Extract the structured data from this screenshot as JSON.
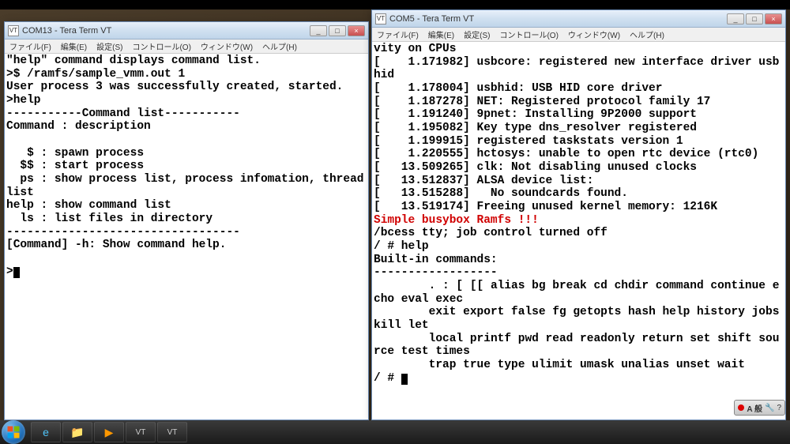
{
  "left_window": {
    "title": "COM13 - Tera Term VT",
    "menu": [
      "ファイル(F)",
      "編集(E)",
      "設定(S)",
      "コントロール(O)",
      "ウィンドウ(W)",
      "ヘルプ(H)"
    ],
    "lines": [
      {
        "t": "\"help\" command displays command list."
      },
      {
        "t": ">$ /ramfs/sample_vmm.out 1"
      },
      {
        "t": "User process 3 was successfully created, started."
      },
      {
        "t": ">help"
      },
      {
        "t": "-----------Command list-----------"
      },
      {
        "t": "Command : description"
      },
      {
        "t": ""
      },
      {
        "t": "   $ : spawn process"
      },
      {
        "t": "  $$ : start process"
      },
      {
        "t": "  ps : show process list, process infomation, thread list"
      },
      {
        "t": "help : show command list"
      },
      {
        "t": "  ls : list files in directory"
      },
      {
        "t": "----------------------------------"
      },
      {
        "t": "[Command] -h: Show command help."
      },
      {
        "t": ""
      }
    ],
    "prompt": ">"
  },
  "right_window": {
    "title": "COM5 - Tera Term VT",
    "menu": [
      "ファイル(F)",
      "編集(E)",
      "設定(S)",
      "コントロール(O)",
      "ウィンドウ(W)",
      "ヘルプ(H)"
    ],
    "lines": [
      {
        "t": "vity on CPUs"
      },
      {
        "t": "[    1.171982] usbcore: registered new interface driver usbhid"
      },
      {
        "t": "[    1.178004] usbhid: USB HID core driver"
      },
      {
        "t": "[    1.187278] NET: Registered protocol family 17"
      },
      {
        "t": "[    1.191240] 9pnet: Installing 9P2000 support"
      },
      {
        "t": "[    1.195082] Key type dns_resolver registered"
      },
      {
        "t": "[    1.199915] registered taskstats version 1"
      },
      {
        "t": "[    1.220555] hctosys: unable to open rtc device (rtc0)"
      },
      {
        "t": "[   13.509265] clk: Not disabling unused clocks"
      },
      {
        "t": "[   13.512837] ALSA device list:"
      },
      {
        "t": "[   13.515288]   No soundcards found."
      },
      {
        "t": "[   13.519174] Freeing unused kernel memory: 1216K"
      },
      {
        "t": "Simple busybox Ramfs !!!",
        "red": true
      },
      {
        "t": "/bcess tty; job control turned off"
      },
      {
        "t": "/ # help"
      },
      {
        "t": "Built-in commands:"
      },
      {
        "t": "------------------"
      },
      {
        "t": "        . : [ [[ alias bg break cd chdir command continue echo eval exec"
      },
      {
        "t": "        exit export false fg getopts hash help history jobs kill let"
      },
      {
        "t": "        local printf pwd read readonly return set shift source test times"
      },
      {
        "t": "        trap true type ulimit umask unalias unset wait"
      }
    ],
    "prompt": "/ # "
  },
  "ime": {
    "text": "A 般"
  },
  "taskbar_icons": [
    "ie",
    "folder",
    "wmp",
    "tt",
    "tt"
  ]
}
